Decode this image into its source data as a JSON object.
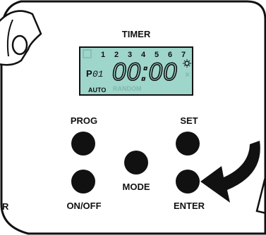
{
  "panel": {
    "title": "TIMER",
    "left_edge_letter": "R"
  },
  "lcd": {
    "background_color": "#9fd6cc",
    "day_numbers": [
      "1",
      "2",
      "3",
      "4",
      "5",
      "6",
      "7"
    ],
    "program_prefix": "P",
    "program_number": "01",
    "time_display": "00:00",
    "mode_text": "AUTO",
    "faded_text": "RANDOM"
  },
  "buttons": {
    "prog": "PROG",
    "set": "SET",
    "mode": "MODE",
    "on_off": "ON/OFF",
    "enter": "ENTER"
  },
  "icons": [
    "bell-icon",
    "sun-icon",
    "arrow-icon"
  ]
}
